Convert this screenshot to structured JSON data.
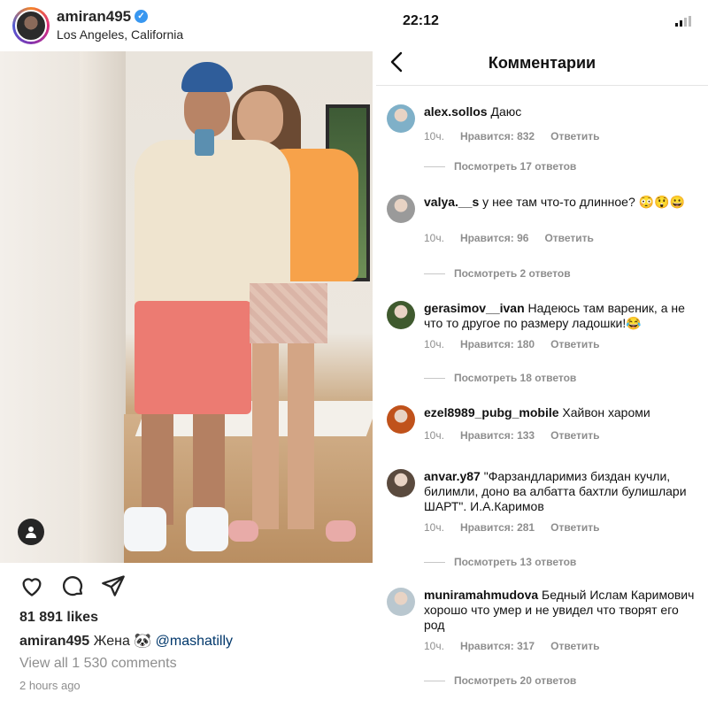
{
  "post": {
    "username": "amiran495",
    "verified_badge": "✓",
    "location": "Los Angeles, California",
    "likes": "81 891 likes",
    "caption_user": "amiran495",
    "caption_text": "Жена 🐼",
    "caption_mention": "@mashatilly",
    "view_comments": "View all 1 530 comments",
    "time_ago": "2 hours ago",
    "icons": [
      "heart-icon",
      "comment-icon",
      "share-icon",
      "user-tag-icon",
      "verified-icon"
    ]
  },
  "status_bar": {
    "time": "22:12"
  },
  "comments_screen": {
    "title": "Комментарии",
    "reply_label": "Ответить",
    "comments": [
      {
        "user": "alex.sollos",
        "text": "Даюс",
        "time": "10ч.",
        "likes": "Нравится: 832",
        "replies": "Посмотреть 17 ответов",
        "avatar_color": "#7fb0c8"
      },
      {
        "user": "valya.__s",
        "text": "у нее там что-то длинное? 😳😲😀",
        "time": "10ч.",
        "likes": "Нравится: 96",
        "replies": "Посмотреть 2 ответов",
        "avatar_color": "#9a9a9a"
      },
      {
        "user": "gerasimov__ivan",
        "text": "Надеюсь там вареник, а не что то другое по размеру ладошки!😂",
        "time": "10ч.",
        "likes": "Нравится: 180",
        "replies": "Посмотреть 18 ответов",
        "avatar_color": "#3f5a2e"
      },
      {
        "user": "ezel8989_pubg_mobile",
        "text": "Хайвон хароми",
        "time": "10ч.",
        "likes": "Нравится: 133",
        "replies": "",
        "avatar_color": "#c0521b"
      },
      {
        "user": "anvar.y87",
        "text": "\"Фарзандларимиз биздан кучли, билимли, доно ва албатта бахтли булишлари ШАРТ\". И.А.Каримов",
        "time": "10ч.",
        "likes": "Нравится: 281",
        "replies": "Посмотреть 13 ответов",
        "avatar_color": "#5a4a3e"
      },
      {
        "user": "muniramahmudova",
        "text": "Бедный Ислам Каримович хорошо что умер и не увидел что творят его род",
        "time": "10ч.",
        "likes": "Нравится: 317",
        "replies": "Посмотреть 20 ответов",
        "avatar_color": "#b9c7cf"
      }
    ]
  }
}
